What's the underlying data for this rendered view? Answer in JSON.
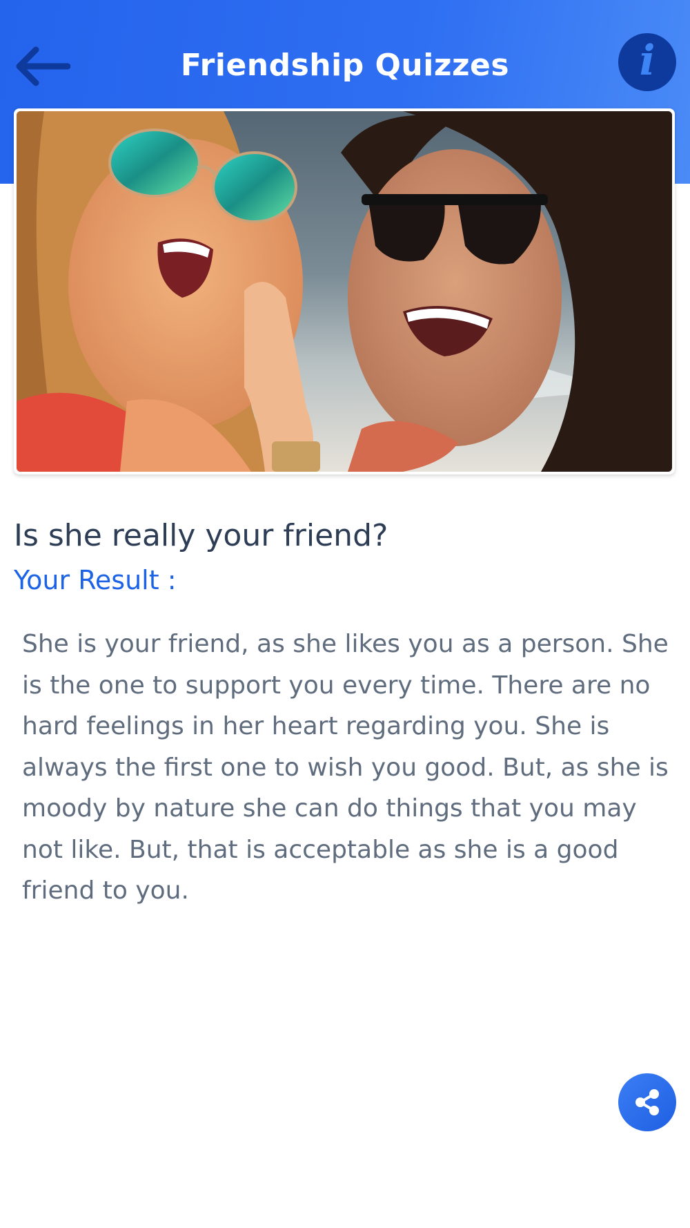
{
  "header": {
    "title": "Friendship Quizzes",
    "back_icon": "arrow-left-icon",
    "info_icon": "info-icon"
  },
  "quiz": {
    "title": "Is she really your friend?",
    "result_label": "Your Result :",
    "result_text": "She is your friend, as she likes you as a person. She is the one to support you every time. There are no hard feelings in her heart regarding you. She is always the first one to wish you good. But, as she is moody by nature she can do things that you may not like. But, that is acceptable as she is a good friend to you."
  },
  "share": {
    "icon": "share-icon"
  },
  "colors": {
    "header_gradient_start": "#2463ec",
    "header_gradient_end": "#4a8bf7",
    "accent": "#1d63e6",
    "title_text": "#2c3d55",
    "body_text": "#5f6c7d",
    "info_button": "#0e3a9e"
  }
}
